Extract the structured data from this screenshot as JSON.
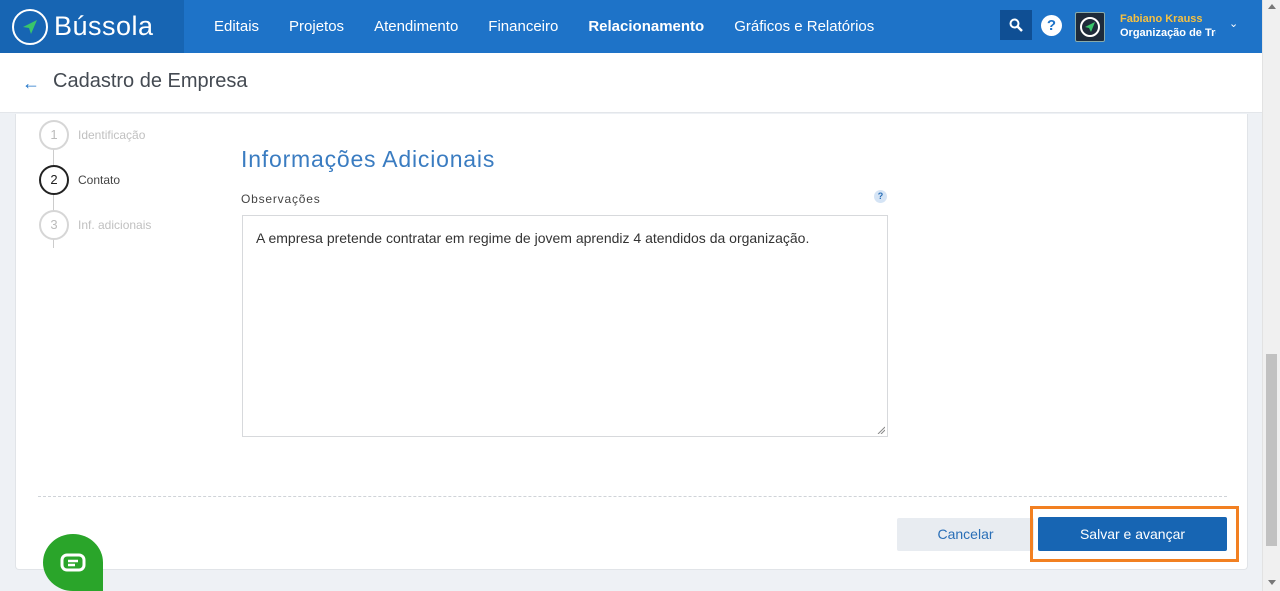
{
  "brand": {
    "name": "Bússola"
  },
  "nav": {
    "items": [
      {
        "label": "Editais"
      },
      {
        "label": "Projetos"
      },
      {
        "label": "Atendimento"
      },
      {
        "label": "Financeiro"
      },
      {
        "label": "Relacionamento"
      },
      {
        "label": "Gráficos e Relatórios"
      }
    ],
    "active": "Relacionamento"
  },
  "user": {
    "name": "Fabiano Krauss",
    "org": "Organização de Tre"
  },
  "header": {
    "title": "Cadastro de Empresa"
  },
  "steps": [
    {
      "number": "1",
      "label": "Identificação"
    },
    {
      "number": "2",
      "label": "Contato"
    },
    {
      "number": "3",
      "label": "Inf. adicionais"
    }
  ],
  "form": {
    "section_title": "Informações Adicionais",
    "observacoes_label": "Observações",
    "help_glyph": "?",
    "observacoes_value": "A empresa pretende contratar em regime de jovem aprendiz 4 atendidos da organização."
  },
  "actions": {
    "cancel": "Cancelar",
    "save": "Salvar e avançar"
  },
  "colors": {
    "primary": "#1e73c8",
    "highlight": "#f28021",
    "chat": "#2aa52a",
    "user_name": "#f5c041"
  }
}
